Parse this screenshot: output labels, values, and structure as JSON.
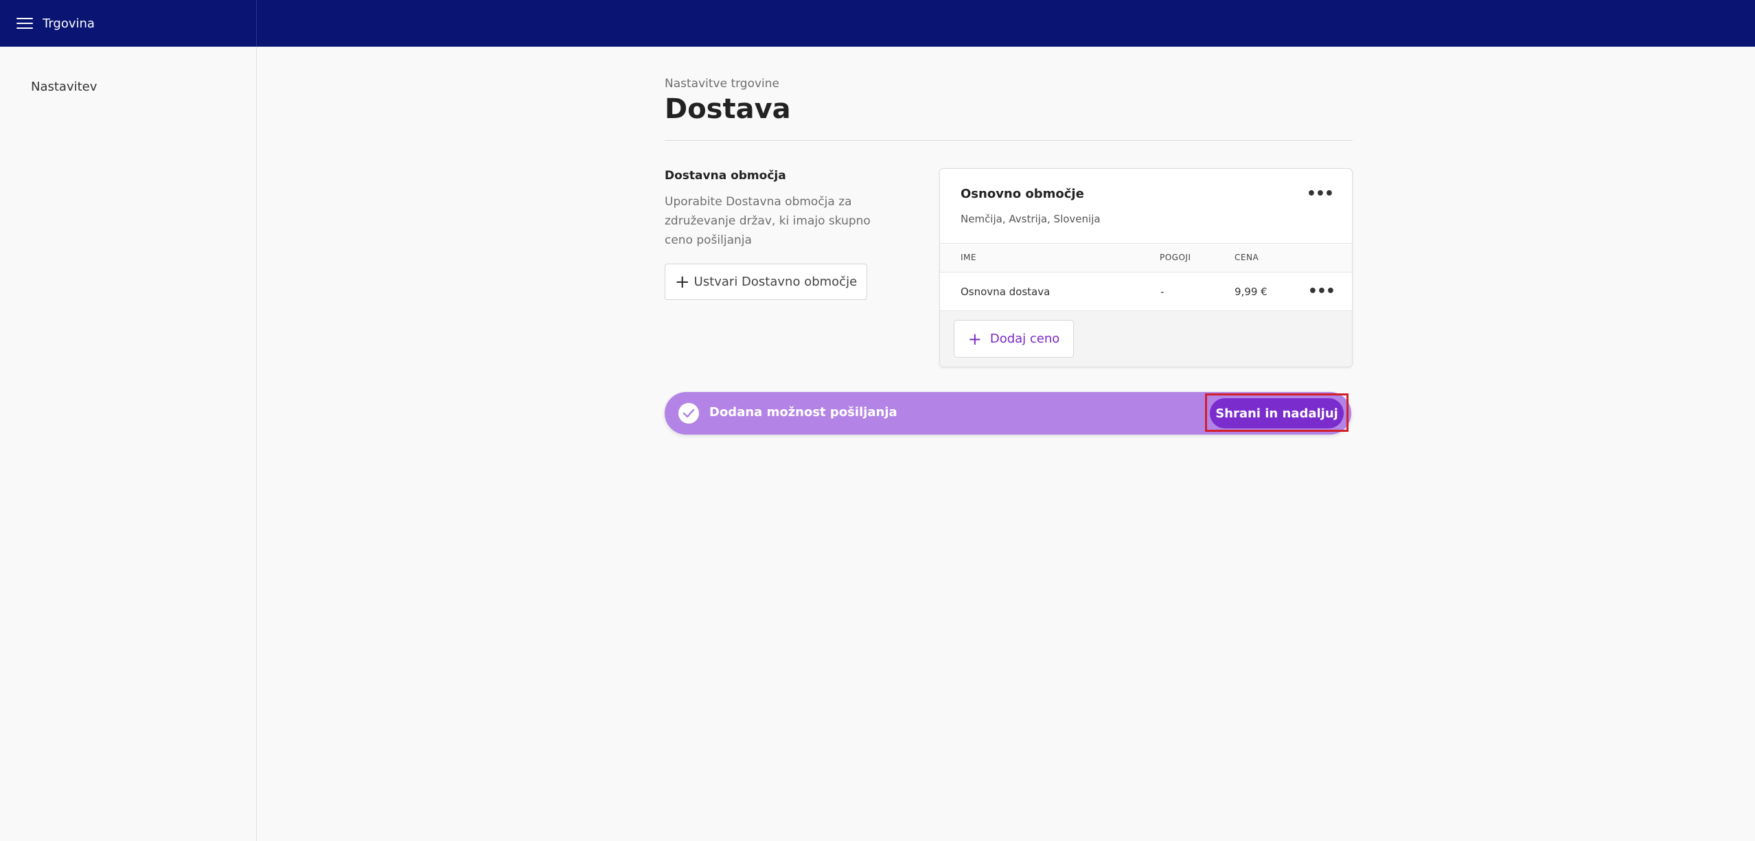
{
  "header": {
    "title": "Trgovina"
  },
  "sidebar": {
    "items": [
      {
        "label": "Nastavitev"
      }
    ]
  },
  "page": {
    "breadcrumb": "Nastavitve trgovine",
    "title": "Dostava"
  },
  "zones_section": {
    "heading": "Dostavna območja",
    "description": "Uporabite Dostavna območja za združevanje držav, ki imajo skupno ceno pošiljanja",
    "create_button": "Ustvari Dostavno območje"
  },
  "zone_card": {
    "name": "Osnovno območje",
    "countries": "Nemčija, Avstrija, Slovenija",
    "menu_icon": "ellipsis-icon",
    "columns": [
      "IME",
      "POGOJI",
      "CENA"
    ],
    "rows": [
      {
        "name": "Osnovna dostava",
        "conditions": "-",
        "price": "9,99 €"
      }
    ],
    "add_price_button": "Dodaj ceno"
  },
  "toast": {
    "message": "Dodana možnost pošiljanja",
    "action_button": "Shrani in nadaljuj",
    "background": "#b384e6",
    "button_color": "#7a2ccd"
  },
  "colors": {
    "topbar": "#091473",
    "accent": "#7a28c4",
    "highlight": "#d11f2b"
  }
}
